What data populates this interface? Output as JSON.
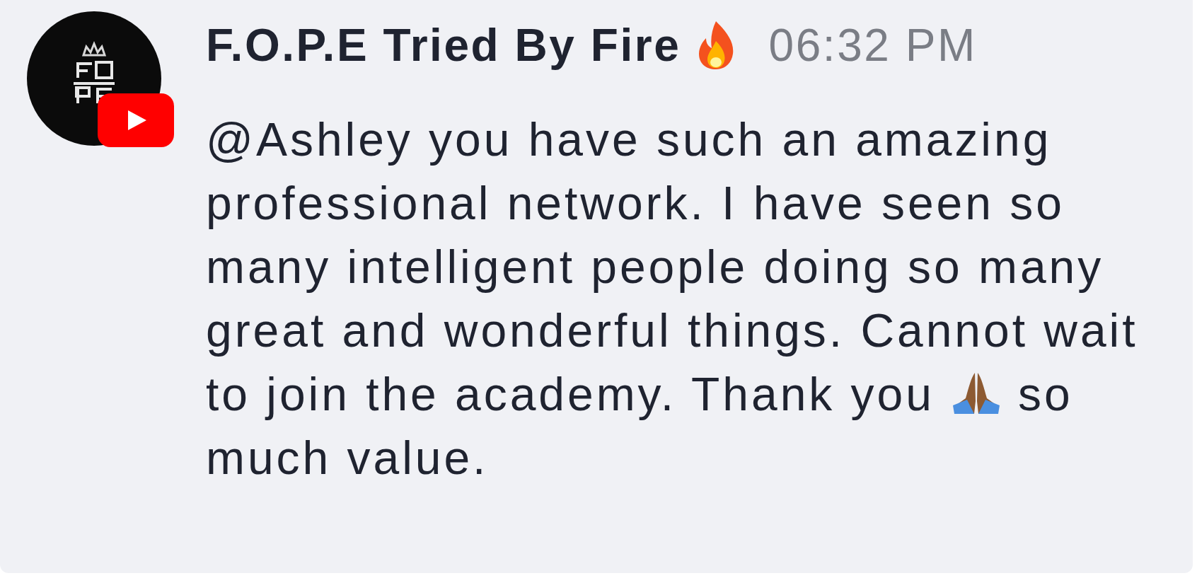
{
  "message": {
    "author": "F.O.P.E Tried By Fire",
    "time": "06:32 PM",
    "lines": [
      {
        "text": "@Ashley you have such an amazing"
      },
      {
        "text": "professional network. I have seen so"
      },
      {
        "text": "many intelligent people doing so many"
      },
      {
        "text": "great and wonderful things. Cannot wait"
      },
      {
        "text": "to join the academy. Thank you",
        "after_icon": "so"
      },
      {
        "text": "much value."
      }
    ]
  }
}
